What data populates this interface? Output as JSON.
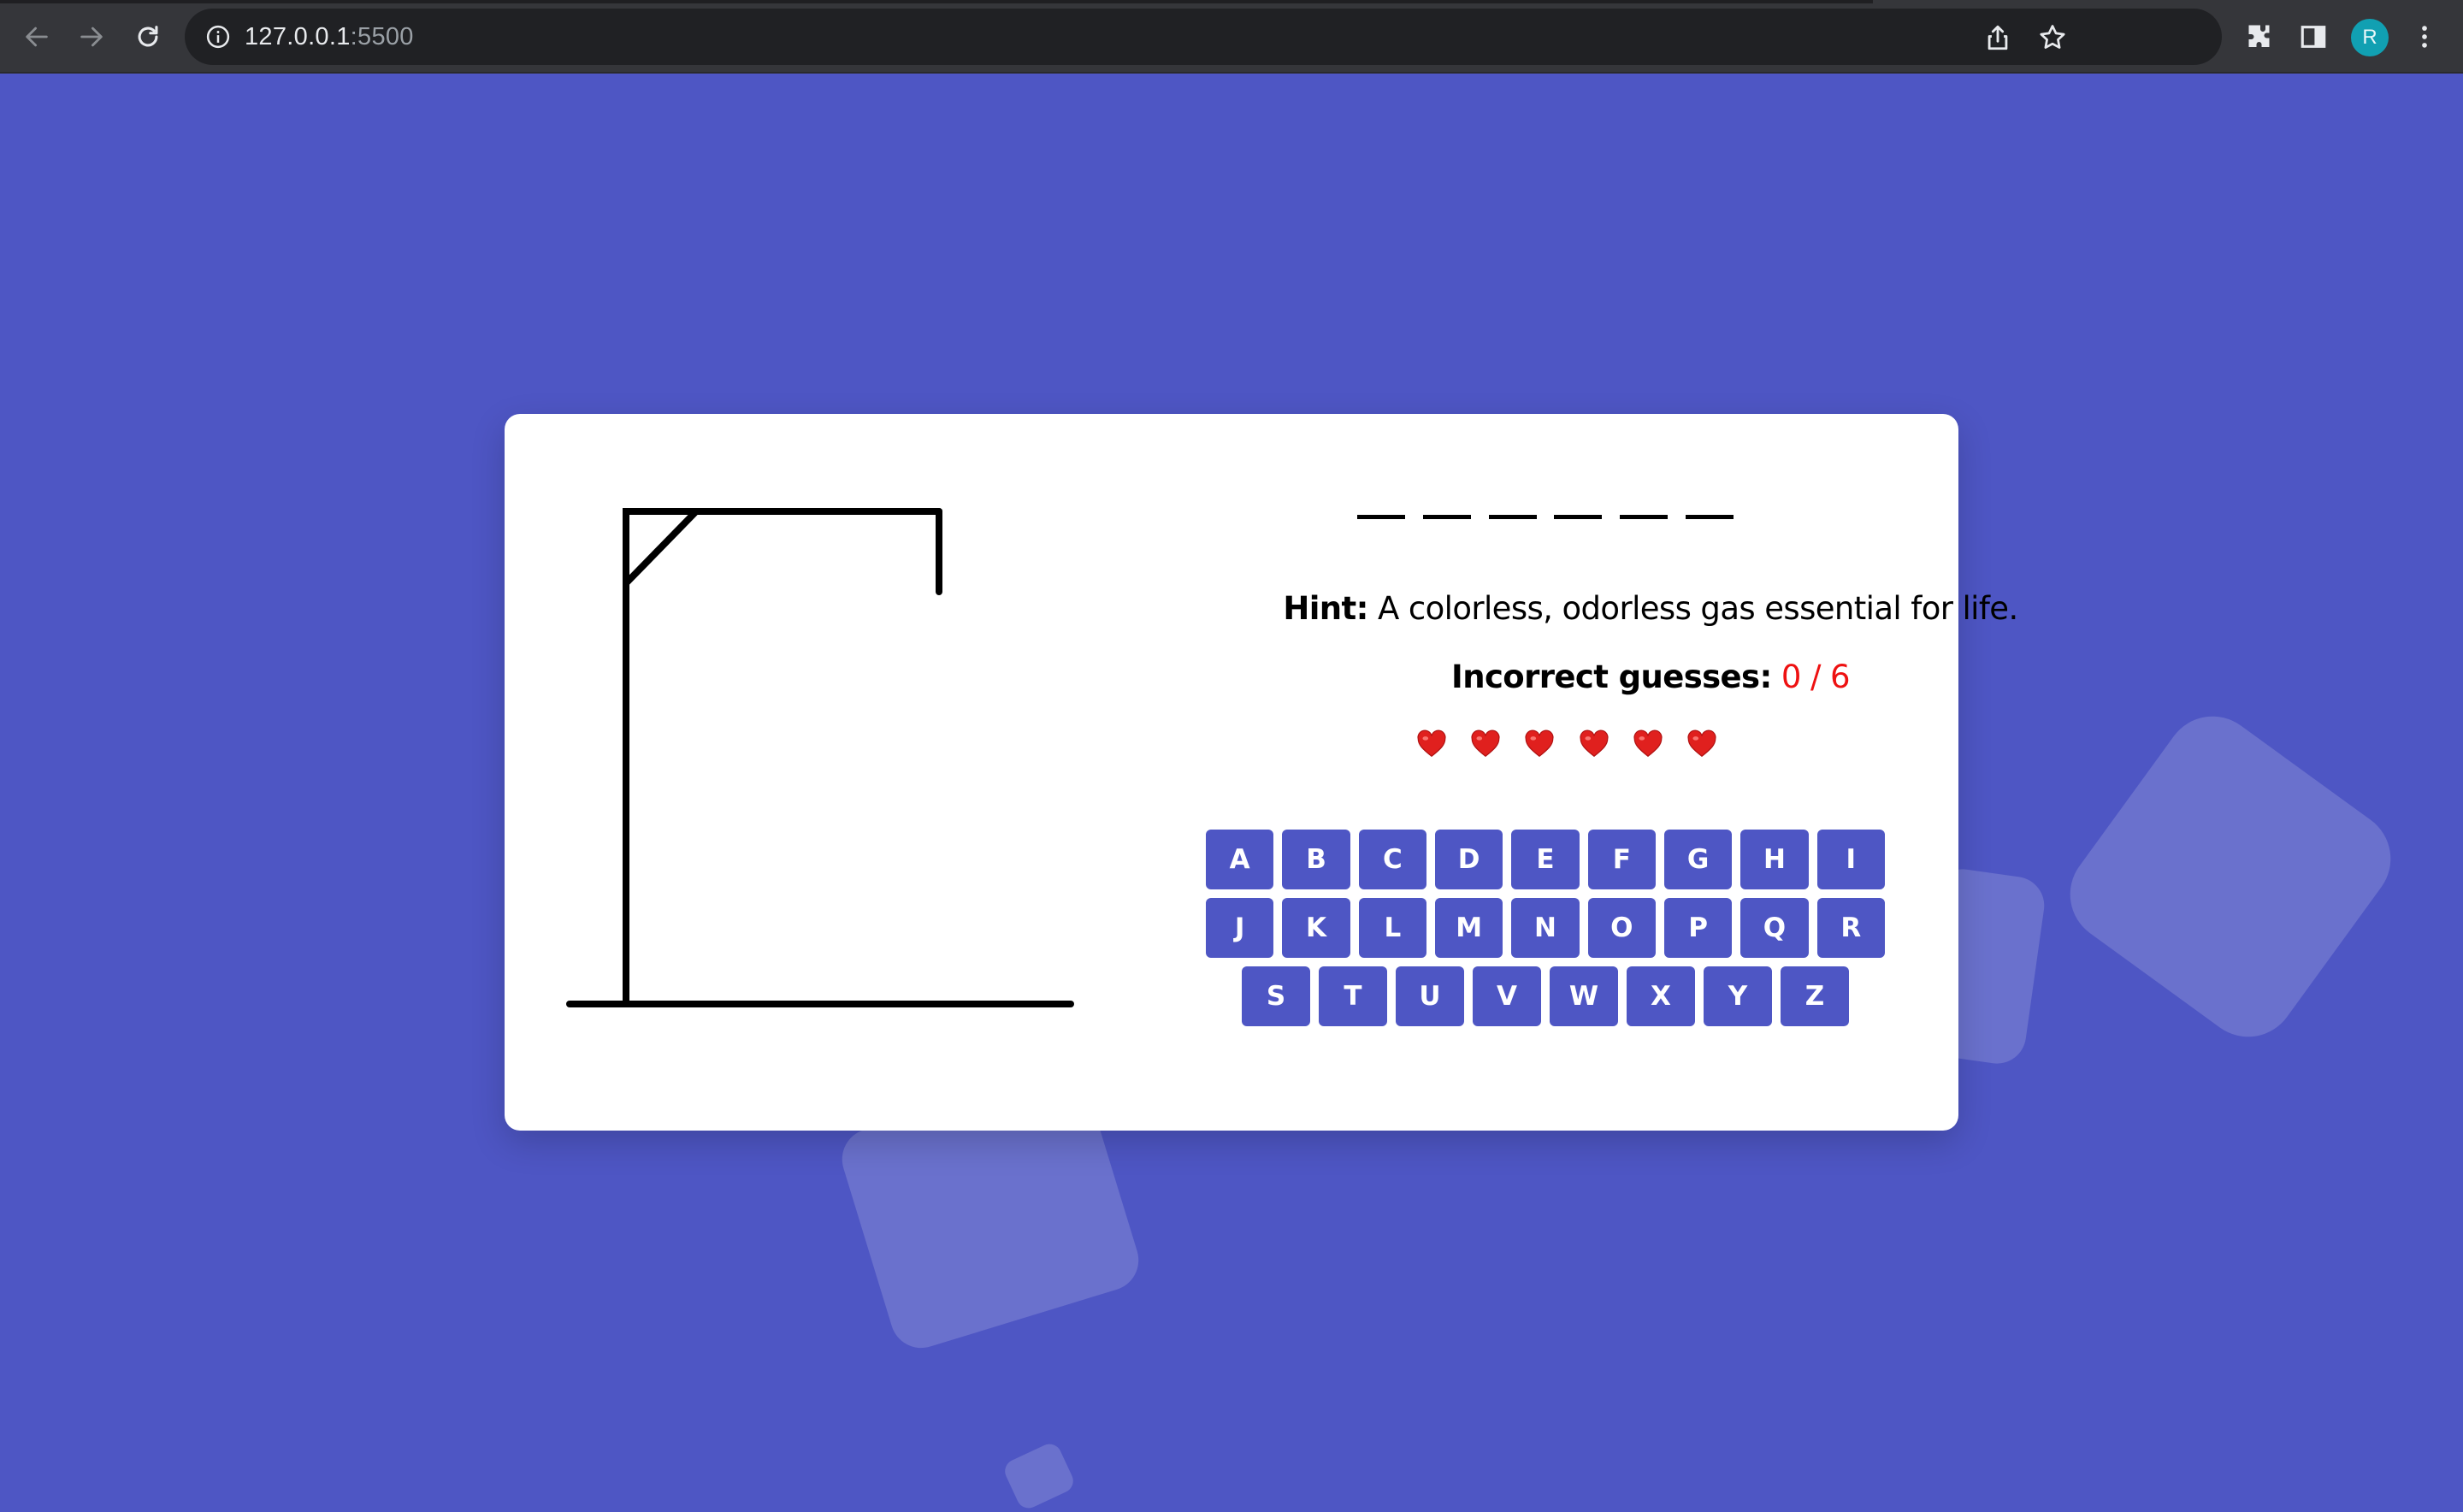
{
  "browser": {
    "url_host": "127.0.0.1",
    "url_port": ":5500",
    "avatar_letter": "R",
    "icons": [
      "back-arrow-icon",
      "forward-arrow-icon",
      "reload-icon",
      "info-icon",
      "share-icon",
      "star-icon",
      "extensions-icon",
      "side-panel-icon",
      "menu-icon"
    ]
  },
  "game": {
    "word_slots": 6,
    "hint_label": "Hint:",
    "hint_text": " A colorless, odorless gas essential for life.",
    "guesses_label": "Incorrect guesses:",
    "guesses_count": "0 / 6",
    "hearts_remaining": 6,
    "keyboard": {
      "row1": [
        "A",
        "B",
        "C",
        "D",
        "E",
        "F",
        "G",
        "H",
        "I"
      ],
      "row2": [
        "J",
        "K",
        "L",
        "M",
        "N",
        "O",
        "P",
        "Q",
        "R"
      ],
      "row3": [
        "S",
        "T",
        "U",
        "V",
        "W",
        "X",
        "Y",
        "Z"
      ]
    }
  },
  "colors": {
    "background": "#4e56c4",
    "key": "#4e56c4",
    "count": "#ee1111",
    "heart": "#e0201e"
  }
}
